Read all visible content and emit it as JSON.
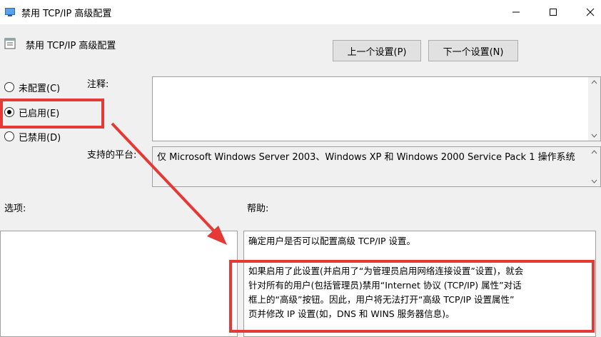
{
  "window": {
    "title": "禁用 TCP/IP 高级配置"
  },
  "header": {
    "title": "禁用 TCP/IP 高级配置"
  },
  "nav": {
    "prev_label": "上一个设置(P)",
    "next_label": "下一个设置(N)"
  },
  "state": {
    "options": [
      {
        "label": "未配置(C)",
        "selected": false
      },
      {
        "label": "已启用(E)",
        "selected": true
      },
      {
        "label": "已禁用(D)",
        "selected": false
      }
    ]
  },
  "comment": {
    "label": "注释:",
    "value": ""
  },
  "platform": {
    "label": "支持的平台:",
    "value": "仅 Microsoft Windows Server 2003、Windows XP 和 Windows 2000 Service Pack 1 操作系统"
  },
  "options_section": {
    "label": "选项:"
  },
  "help": {
    "label": "帮助:",
    "paragraph1": "确定用户是否可以配置高级 TCP/IP 设置。",
    "line1": "如果启用了此设置(并启用了“为管理员启用网络连接设置”设置)，就会",
    "line2": "针对所有的用户(包括管理员)禁用“Internet 协议 (TCP/IP) 属性”对话",
    "line3": "框上的“高级”按钮。因此，用户将无法打开“高级 TCP/IP 设置属性”",
    "line4": "页并修改 IP 设置(如，DNS 和 WINS 服务器信息)。"
  },
  "annotation": {
    "color": "#e53935"
  }
}
